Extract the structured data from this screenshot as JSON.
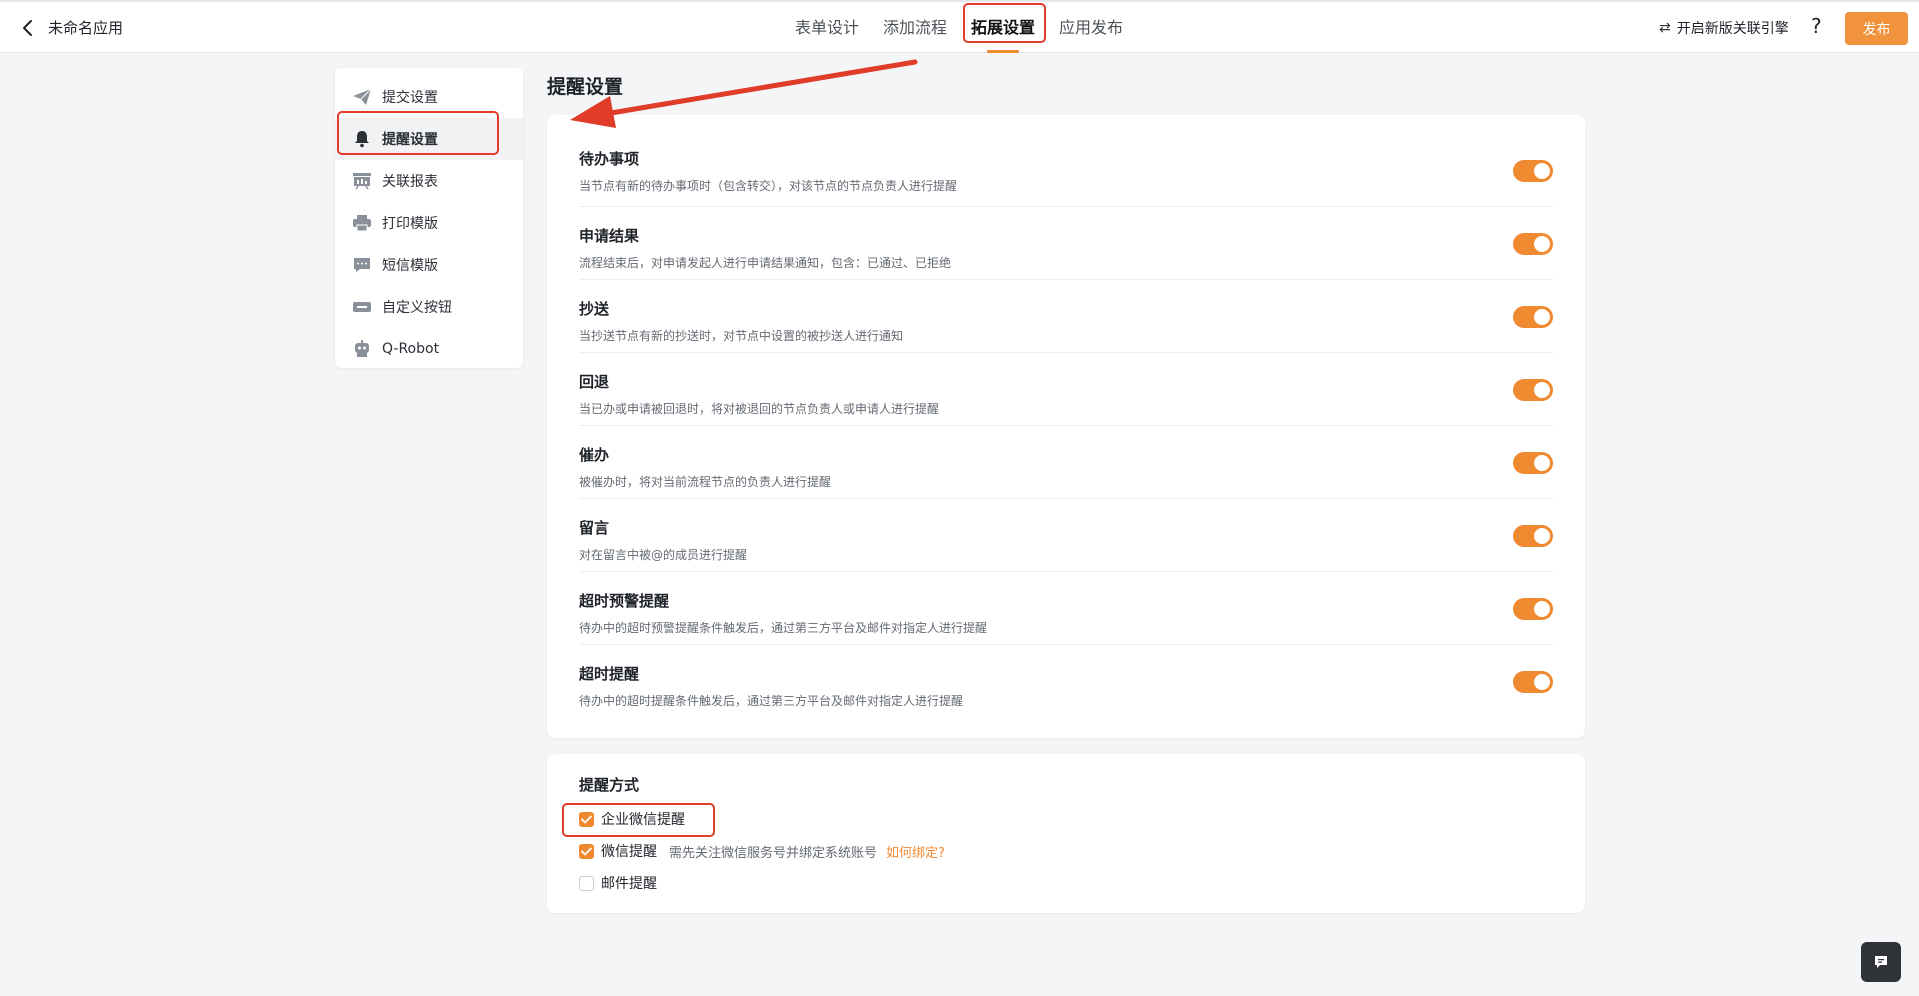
{
  "header": {
    "app_title": "未命名应用",
    "tabs": [
      {
        "label": "表单设计",
        "active": false
      },
      {
        "label": "添加流程",
        "active": false
      },
      {
        "label": "拓展设置",
        "active": true
      },
      {
        "label": "应用发布",
        "active": false
      }
    ],
    "engine_label": "开启新版关联引擎",
    "help_label": "?",
    "publish_label": "发布"
  },
  "sidebar": {
    "items": [
      {
        "label": "提交设置",
        "icon": "paper-plane-icon",
        "active": false
      },
      {
        "label": "提醒设置",
        "icon": "bell-icon",
        "active": true
      },
      {
        "label": "关联报表",
        "icon": "report-icon",
        "active": false
      },
      {
        "label": "打印模版",
        "icon": "printer-icon",
        "active": false
      },
      {
        "label": "短信模版",
        "icon": "message-icon",
        "active": false
      },
      {
        "label": "自定义按钮",
        "icon": "custom-button-icon",
        "active": false
      },
      {
        "label": "Q-Robot",
        "icon": "robot-icon",
        "active": false
      }
    ]
  },
  "main": {
    "section_title": "提醒设置",
    "reminders": [
      {
        "title": "待办事项",
        "desc": "当节点有新的待办事项时（包含转交），对该节点的节点负责人进行提醒",
        "enabled": true
      },
      {
        "title": "申请结果",
        "desc": "流程结束后，对申请发起人进行申请结果通知，包含：已通过、已拒绝",
        "enabled": true
      },
      {
        "title": "抄送",
        "desc": "当抄送节点有新的抄送时，对节点中设置的被抄送人进行通知",
        "enabled": true
      },
      {
        "title": "回退",
        "desc": "当已办或申请被回退时，将对被退回的节点负责人或申请人进行提醒",
        "enabled": true
      },
      {
        "title": "催办",
        "desc": "被催办时，将对当前流程节点的负责人进行提醒",
        "enabled": true
      },
      {
        "title": "留言",
        "desc": "对在留言中被@的成员进行提醒",
        "enabled": true
      },
      {
        "title": "超时预警提醒",
        "desc": "待办中的超时预警提醒条件触发后，通过第三方平台及邮件对指定人进行提醒",
        "enabled": true
      },
      {
        "title": "超时提醒",
        "desc": "待办中的超时提醒条件触发后，通过第三方平台及邮件对指定人进行提醒",
        "enabled": true
      }
    ],
    "methods": {
      "title": "提醒方式",
      "options": [
        {
          "label": "企业微信提醒",
          "checked": true
        },
        {
          "label": "微信提醒",
          "checked": true,
          "hint": "需先关注微信服务号并绑定系统账号",
          "link": "如何绑定?"
        },
        {
          "label": "邮件提醒",
          "checked": false
        }
      ]
    }
  },
  "colors": {
    "accent": "#f08a30",
    "annotation_red": "#e13b2a"
  }
}
